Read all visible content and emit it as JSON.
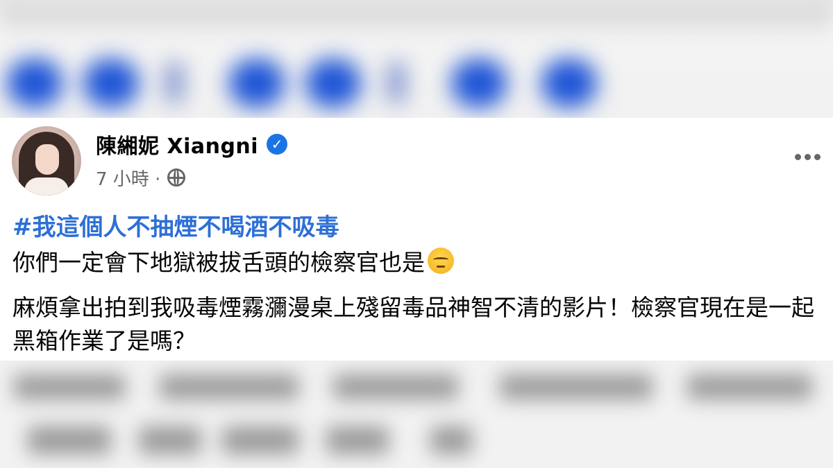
{
  "post": {
    "author": "陳緗妮 Xiangni",
    "verified_icon": "verified-badge-icon",
    "time": "7 小時 ·",
    "audience_icon": "globe-icon",
    "more_icon": "more-options-icon",
    "hashtag": "#我這個人不抽煙不喝酒不吸毒",
    "line2": "你們一定會下地獄被拔舌頭的檢察官也是",
    "emoji_icon": "relieved-face-emoji",
    "paragraph": "麻煩拿出拍到我吸毒煙霧瀰漫桌上殘留毒品神智不清的影片！檢察官現在是一起黑箱作業了是嗎？"
  },
  "colors": {
    "hashtag": "#2d6fd6",
    "verified": "#1b74e4",
    "meta": "#65676b"
  }
}
